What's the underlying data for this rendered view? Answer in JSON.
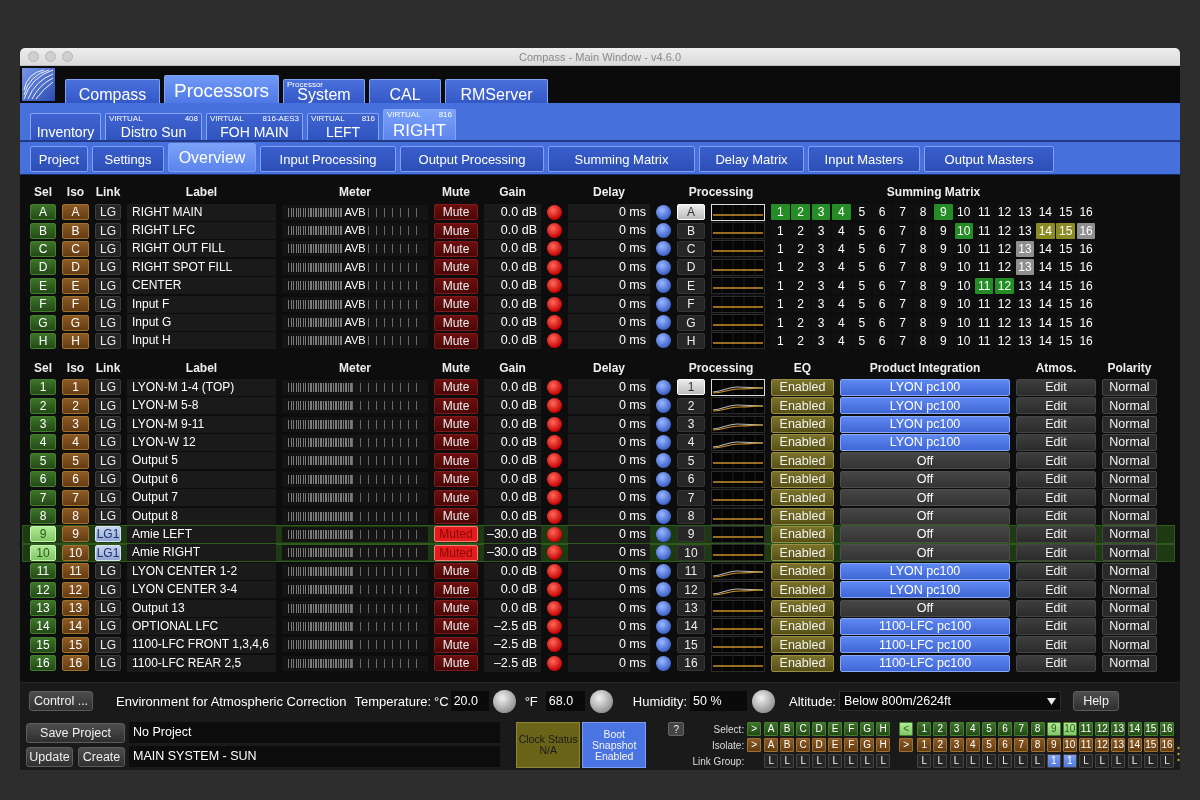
{
  "window": {
    "title": "Compass - Main Window - v4.6.0"
  },
  "main_tabs": [
    {
      "label": "Compass",
      "selected": false
    },
    {
      "label": "Processors",
      "selected": true
    },
    {
      "label": "System",
      "caption": "Processor",
      "selected": false
    },
    {
      "label": "CAL",
      "selected": false
    },
    {
      "label": "RMServer",
      "selected": false
    }
  ],
  "processor_tabs": [
    {
      "label": "Inventory",
      "selected": false
    },
    {
      "label": "Distro Sun",
      "tag": "VIRTUAL",
      "model": "408",
      "selected": false
    },
    {
      "label": "FOH MAIN",
      "tag": "VIRTUAL",
      "model": "816-AES3",
      "selected": false
    },
    {
      "label": "LEFT",
      "tag": "VIRTUAL",
      "model": "816",
      "selected": false
    },
    {
      "label": "RIGHT",
      "tag": "VIRTUAL",
      "model": "816",
      "selected": true
    }
  ],
  "view_tabs": [
    {
      "label": "Project",
      "selected": false
    },
    {
      "label": "Settings",
      "selected": false
    },
    {
      "label": "Overview",
      "selected": true
    },
    {
      "label": "Input Processing",
      "selected": false
    },
    {
      "label": "Output Processing",
      "selected": false
    },
    {
      "label": "Summing Matrix",
      "selected": false
    },
    {
      "label": "Delay Matrix",
      "selected": false
    },
    {
      "label": "Input Masters",
      "selected": false
    },
    {
      "label": "Output Masters",
      "selected": false
    }
  ],
  "inputs": {
    "columns": [
      "Sel",
      "Iso",
      "Link",
      "Label",
      "Meter",
      "Mute",
      "Gain",
      "Delay",
      "Processing",
      "Summing Matrix"
    ],
    "rows": [
      {
        "sel": "A",
        "iso": "A",
        "link": "LG",
        "linked": false,
        "label": "RIGHT MAIN",
        "meter_source": "AVB",
        "mute": "Mute",
        "muted": false,
        "gain": "0.0 dB",
        "delay": "0 ms",
        "processing": {
          "label": "A",
          "selected": true,
          "kind": "flat"
        },
        "selected": false,
        "matrix": [
          {
            "label": "1",
            "color": "#258d25"
          },
          {
            "label": "2",
            "color": "#258d25"
          },
          {
            "label": "3",
            "color": "#258d25"
          },
          {
            "label": "4",
            "color": "#258d25"
          },
          {
            "label": "5",
            "color": "#101010"
          },
          {
            "label": "6",
            "color": "#101010"
          },
          {
            "label": "7",
            "color": "#101010"
          },
          {
            "label": "8",
            "color": "#101010"
          },
          {
            "label": "9",
            "color": "#258d25"
          },
          {
            "label": "10",
            "color": "#101010"
          },
          {
            "label": "11",
            "color": "#101010"
          },
          {
            "label": "12",
            "color": "#101010"
          },
          {
            "label": "13",
            "color": "#101010"
          },
          {
            "label": "14",
            "color": "#101010"
          },
          {
            "label": "15",
            "color": "#101010"
          },
          {
            "label": "16",
            "color": "#101010"
          }
        ]
      },
      {
        "sel": "B",
        "iso": "B",
        "link": "LG",
        "linked": false,
        "label": "RIGHT LFC",
        "meter_source": "AVB",
        "mute": "Mute",
        "muted": false,
        "gain": "0.0 dB",
        "delay": "0 ms",
        "processing": {
          "label": "B",
          "selected": false,
          "kind": "flat"
        },
        "selected": false,
        "matrix": [
          {
            "label": "1",
            "color": "#101010"
          },
          {
            "label": "2",
            "color": "#101010"
          },
          {
            "label": "3",
            "color": "#101010"
          },
          {
            "label": "4",
            "color": "#101010"
          },
          {
            "label": "5",
            "color": "#101010"
          },
          {
            "label": "6",
            "color": "#101010"
          },
          {
            "label": "7",
            "color": "#101010"
          },
          {
            "label": "8",
            "color": "#101010"
          },
          {
            "label": "9",
            "color": "#101010"
          },
          {
            "label": "10",
            "color": "#258d25"
          },
          {
            "label": "11",
            "color": "#101010"
          },
          {
            "label": "12",
            "color": "#101010"
          },
          {
            "label": "13",
            "color": "#101010"
          },
          {
            "label": "14",
            "color": "#8b8b26"
          },
          {
            "label": "15",
            "color": "#8b8b26"
          },
          {
            "label": "16",
            "color": "#8f8f8f"
          }
        ]
      },
      {
        "sel": "C",
        "iso": "C",
        "link": "LG",
        "linked": false,
        "label": "RIGHT OUT FILL",
        "meter_source": "AVB",
        "mute": "Mute",
        "muted": false,
        "gain": "0.0 dB",
        "delay": "0 ms",
        "processing": {
          "label": "C",
          "selected": false,
          "kind": "flat"
        },
        "selected": false,
        "matrix": [
          {
            "label": "1",
            "color": "#101010"
          },
          {
            "label": "2",
            "color": "#101010"
          },
          {
            "label": "3",
            "color": "#101010"
          },
          {
            "label": "4",
            "color": "#101010"
          },
          {
            "label": "5",
            "color": "#101010"
          },
          {
            "label": "6",
            "color": "#101010"
          },
          {
            "label": "7",
            "color": "#101010"
          },
          {
            "label": "8",
            "color": "#101010"
          },
          {
            "label": "9",
            "color": "#101010"
          },
          {
            "label": "10",
            "color": "#101010"
          },
          {
            "label": "11",
            "color": "#101010"
          },
          {
            "label": "12",
            "color": "#101010"
          },
          {
            "label": "13",
            "color": "#8f8f8f"
          },
          {
            "label": "14",
            "color": "#101010"
          },
          {
            "label": "15",
            "color": "#101010"
          },
          {
            "label": "16",
            "color": "#101010"
          }
        ]
      },
      {
        "sel": "D",
        "iso": "D",
        "link": "LG",
        "linked": false,
        "label": "RIGHT SPOT FILL",
        "meter_source": "AVB",
        "mute": "Mute",
        "muted": false,
        "gain": "0.0 dB",
        "delay": "0 ms",
        "processing": {
          "label": "D",
          "selected": false,
          "kind": "flat"
        },
        "selected": false,
        "matrix": [
          {
            "label": "1",
            "color": "#101010"
          },
          {
            "label": "2",
            "color": "#101010"
          },
          {
            "label": "3",
            "color": "#101010"
          },
          {
            "label": "4",
            "color": "#101010"
          },
          {
            "label": "5",
            "color": "#101010"
          },
          {
            "label": "6",
            "color": "#101010"
          },
          {
            "label": "7",
            "color": "#101010"
          },
          {
            "label": "8",
            "color": "#101010"
          },
          {
            "label": "9",
            "color": "#101010"
          },
          {
            "label": "10",
            "color": "#101010"
          },
          {
            "label": "11",
            "color": "#101010"
          },
          {
            "label": "12",
            "color": "#101010"
          },
          {
            "label": "13",
            "color": "#8f8f8f"
          },
          {
            "label": "14",
            "color": "#101010"
          },
          {
            "label": "15",
            "color": "#101010"
          },
          {
            "label": "16",
            "color": "#101010"
          }
        ]
      },
      {
        "sel": "E",
        "iso": "E",
        "link": "LG",
        "linked": false,
        "label": "CENTER",
        "meter_source": "AVB",
        "mute": "Mute",
        "muted": false,
        "gain": "0.0 dB",
        "delay": "0 ms",
        "processing": {
          "label": "E",
          "selected": false,
          "kind": "flat"
        },
        "selected": false,
        "matrix": [
          {
            "label": "1",
            "color": "#101010"
          },
          {
            "label": "2",
            "color": "#101010"
          },
          {
            "label": "3",
            "color": "#101010"
          },
          {
            "label": "4",
            "color": "#101010"
          },
          {
            "label": "5",
            "color": "#101010"
          },
          {
            "label": "6",
            "color": "#101010"
          },
          {
            "label": "7",
            "color": "#101010"
          },
          {
            "label": "8",
            "color": "#101010"
          },
          {
            "label": "9",
            "color": "#101010"
          },
          {
            "label": "10",
            "color": "#101010"
          },
          {
            "label": "11",
            "color": "#258d25"
          },
          {
            "label": "12",
            "color": "#258d25"
          },
          {
            "label": "13",
            "color": "#101010"
          },
          {
            "label": "14",
            "color": "#101010"
          },
          {
            "label": "15",
            "color": "#101010"
          },
          {
            "label": "16",
            "color": "#101010"
          }
        ]
      },
      {
        "sel": "F",
        "iso": "F",
        "link": "LG",
        "linked": false,
        "label": "Input F",
        "meter_source": "AVB",
        "mute": "Mute",
        "muted": false,
        "gain": "0.0 dB",
        "delay": "0 ms",
        "processing": {
          "label": "F",
          "selected": false,
          "kind": "flat"
        },
        "selected": false,
        "matrix": [
          {
            "label": "1",
            "color": "#101010"
          },
          {
            "label": "2",
            "color": "#101010"
          },
          {
            "label": "3",
            "color": "#101010"
          },
          {
            "label": "4",
            "color": "#101010"
          },
          {
            "label": "5",
            "color": "#101010"
          },
          {
            "label": "6",
            "color": "#101010"
          },
          {
            "label": "7",
            "color": "#101010"
          },
          {
            "label": "8",
            "color": "#101010"
          },
          {
            "label": "9",
            "color": "#101010"
          },
          {
            "label": "10",
            "color": "#101010"
          },
          {
            "label": "11",
            "color": "#101010"
          },
          {
            "label": "12",
            "color": "#101010"
          },
          {
            "label": "13",
            "color": "#101010"
          },
          {
            "label": "14",
            "color": "#101010"
          },
          {
            "label": "15",
            "color": "#101010"
          },
          {
            "label": "16",
            "color": "#101010"
          }
        ]
      },
      {
        "sel": "G",
        "iso": "G",
        "link": "LG",
        "linked": false,
        "label": "Input G",
        "meter_source": "AVB",
        "mute": "Mute",
        "muted": false,
        "gain": "0.0 dB",
        "delay": "0 ms",
        "processing": {
          "label": "G",
          "selected": false,
          "kind": "flat"
        },
        "selected": false,
        "matrix": [
          {
            "label": "1",
            "color": "#101010"
          },
          {
            "label": "2",
            "color": "#101010"
          },
          {
            "label": "3",
            "color": "#101010"
          },
          {
            "label": "4",
            "color": "#101010"
          },
          {
            "label": "5",
            "color": "#101010"
          },
          {
            "label": "6",
            "color": "#101010"
          },
          {
            "label": "7",
            "color": "#101010"
          },
          {
            "label": "8",
            "color": "#101010"
          },
          {
            "label": "9",
            "color": "#101010"
          },
          {
            "label": "10",
            "color": "#101010"
          },
          {
            "label": "11",
            "color": "#101010"
          },
          {
            "label": "12",
            "color": "#101010"
          },
          {
            "label": "13",
            "color": "#101010"
          },
          {
            "label": "14",
            "color": "#101010"
          },
          {
            "label": "15",
            "color": "#101010"
          },
          {
            "label": "16",
            "color": "#101010"
          }
        ]
      },
      {
        "sel": "H",
        "iso": "H",
        "link": "LG",
        "linked": false,
        "label": "Input H",
        "meter_source": "AVB",
        "mute": "Mute",
        "muted": false,
        "gain": "0.0 dB",
        "delay": "0 ms",
        "processing": {
          "label": "H",
          "selected": false,
          "kind": "flat"
        },
        "selected": false,
        "matrix": [
          {
            "label": "1",
            "color": "#101010"
          },
          {
            "label": "2",
            "color": "#101010"
          },
          {
            "label": "3",
            "color": "#101010"
          },
          {
            "label": "4",
            "color": "#101010"
          },
          {
            "label": "5",
            "color": "#101010"
          },
          {
            "label": "6",
            "color": "#101010"
          },
          {
            "label": "7",
            "color": "#101010"
          },
          {
            "label": "8",
            "color": "#101010"
          },
          {
            "label": "9",
            "color": "#101010"
          },
          {
            "label": "10",
            "color": "#101010"
          },
          {
            "label": "11",
            "color": "#101010"
          },
          {
            "label": "12",
            "color": "#101010"
          },
          {
            "label": "13",
            "color": "#101010"
          },
          {
            "label": "14",
            "color": "#101010"
          },
          {
            "label": "15",
            "color": "#101010"
          },
          {
            "label": "16",
            "color": "#101010"
          }
        ]
      }
    ]
  },
  "outputs": {
    "columns": [
      "Sel",
      "Iso",
      "Link",
      "Label",
      "Meter",
      "Mute",
      "Gain",
      "Delay",
      "Processing",
      "EQ",
      "Product Integration",
      "Atmos.",
      "Polarity"
    ],
    "rows": [
      {
        "sel": "1",
        "iso": "1",
        "link": "LG",
        "linked": false,
        "label": "LYON-M 1-4 (TOP)",
        "mute": "Mute",
        "muted": false,
        "gain": "0.0 dB",
        "delay": "0 ms",
        "processing": {
          "label": "1",
          "selected": true,
          "kind": "shaped"
        },
        "selected": false,
        "eq": "Enabled",
        "integration": "LYON pc100",
        "integration_active": true,
        "atmos": "Edit",
        "polarity": "Normal"
      },
      {
        "sel": "2",
        "iso": "2",
        "link": "LG",
        "linked": false,
        "label": "LYON-M 5-8",
        "mute": "Mute",
        "muted": false,
        "gain": "0.0 dB",
        "delay": "0 ms",
        "processing": {
          "label": "2",
          "selected": false,
          "kind": "shaped"
        },
        "selected": false,
        "eq": "Enabled",
        "integration": "LYON pc100",
        "integration_active": true,
        "atmos": "Edit",
        "polarity": "Normal"
      },
      {
        "sel": "3",
        "iso": "3",
        "link": "LG",
        "linked": false,
        "label": "LYON-M 9-11",
        "mute": "Mute",
        "muted": false,
        "gain": "0.0 dB",
        "delay": "0 ms",
        "processing": {
          "label": "3",
          "selected": false,
          "kind": "shaped"
        },
        "selected": false,
        "eq": "Enabled",
        "integration": "LYON pc100",
        "integration_active": true,
        "atmos": "Edit",
        "polarity": "Normal"
      },
      {
        "sel": "4",
        "iso": "4",
        "link": "LG",
        "linked": false,
        "label": "LYON-W 12",
        "mute": "Mute",
        "muted": false,
        "gain": "0.0 dB",
        "delay": "0 ms",
        "processing": {
          "label": "4",
          "selected": false,
          "kind": "shaped"
        },
        "selected": false,
        "eq": "Enabled",
        "integration": "LYON pc100",
        "integration_active": true,
        "atmos": "Edit",
        "polarity": "Normal"
      },
      {
        "sel": "5",
        "iso": "5",
        "link": "LG",
        "linked": false,
        "label": "Output 5",
        "mute": "Mute",
        "muted": false,
        "gain": "0.0 dB",
        "delay": "0 ms",
        "processing": {
          "label": "5",
          "selected": false,
          "kind": "flat"
        },
        "selected": false,
        "eq": "Enabled",
        "integration": "Off",
        "integration_active": false,
        "atmos": "Edit",
        "polarity": "Normal"
      },
      {
        "sel": "6",
        "iso": "6",
        "link": "LG",
        "linked": false,
        "label": "Output 6",
        "mute": "Mute",
        "muted": false,
        "gain": "0.0 dB",
        "delay": "0 ms",
        "processing": {
          "label": "6",
          "selected": false,
          "kind": "flat"
        },
        "selected": false,
        "eq": "Enabled",
        "integration": "Off",
        "integration_active": false,
        "atmos": "Edit",
        "polarity": "Normal"
      },
      {
        "sel": "7",
        "iso": "7",
        "link": "LG",
        "linked": false,
        "label": "Output 7",
        "mute": "Mute",
        "muted": false,
        "gain": "0.0 dB",
        "delay": "0 ms",
        "processing": {
          "label": "7",
          "selected": false,
          "kind": "flat"
        },
        "selected": false,
        "eq": "Enabled",
        "integration": "Off",
        "integration_active": false,
        "atmos": "Edit",
        "polarity": "Normal"
      },
      {
        "sel": "8",
        "iso": "8",
        "link": "LG",
        "linked": false,
        "label": "Output 8",
        "mute": "Mute",
        "muted": false,
        "gain": "0.0 dB",
        "delay": "0 ms",
        "processing": {
          "label": "8",
          "selected": false,
          "kind": "flat"
        },
        "selected": false,
        "eq": "Enabled",
        "integration": "Off",
        "integration_active": false,
        "atmos": "Edit",
        "polarity": "Normal"
      },
      {
        "sel": "9",
        "iso": "9",
        "link": "LG1",
        "linked": true,
        "label": "Amie LEFT",
        "mute": "Muted",
        "muted": true,
        "gain": "–30.0 dB",
        "delay": "0 ms",
        "processing": {
          "label": "9",
          "selected": false,
          "kind": "flat"
        },
        "selected": true,
        "eq": "Enabled",
        "integration": "Off",
        "integration_active": false,
        "atmos": "Edit",
        "polarity": "Normal"
      },
      {
        "sel": "10",
        "iso": "10",
        "link": "LG1",
        "linked": true,
        "label": "Amie RIGHT",
        "mute": "Muted",
        "muted": true,
        "gain": "–30.0 dB",
        "delay": "0 ms",
        "processing": {
          "label": "10",
          "selected": false,
          "kind": "flat"
        },
        "selected": true,
        "eq": "Enabled",
        "integration": "Off",
        "integration_active": false,
        "atmos": "Edit",
        "polarity": "Normal"
      },
      {
        "sel": "11",
        "iso": "11",
        "link": "LG",
        "linked": false,
        "label": "LYON CENTER 1-2",
        "mute": "Mute",
        "muted": false,
        "gain": "0.0 dB",
        "delay": "0 ms",
        "processing": {
          "label": "11",
          "selected": false,
          "kind": "shaped"
        },
        "selected": false,
        "eq": "Enabled",
        "integration": "LYON pc100",
        "integration_active": true,
        "atmos": "Edit",
        "polarity": "Normal"
      },
      {
        "sel": "12",
        "iso": "12",
        "link": "LG",
        "linked": false,
        "label": "LYON CENTER 3-4",
        "mute": "Mute",
        "muted": false,
        "gain": "0.0 dB",
        "delay": "0 ms",
        "processing": {
          "label": "12",
          "selected": false,
          "kind": "shaped"
        },
        "selected": false,
        "eq": "Enabled",
        "integration": "LYON pc100",
        "integration_active": true,
        "atmos": "Edit",
        "polarity": "Normal"
      },
      {
        "sel": "13",
        "iso": "13",
        "link": "LG",
        "linked": false,
        "label": "Output 13",
        "mute": "Mute",
        "muted": false,
        "gain": "0.0 dB",
        "delay": "0 ms",
        "processing": {
          "label": "13",
          "selected": false,
          "kind": "flat"
        },
        "selected": false,
        "eq": "Enabled",
        "integration": "Off",
        "integration_active": false,
        "atmos": "Edit",
        "polarity": "Normal"
      },
      {
        "sel": "14",
        "iso": "14",
        "link": "LG",
        "linked": false,
        "label": "OPTIONAL LFC",
        "mute": "Mute",
        "muted": false,
        "gain": "–2.5 dB",
        "delay": "0 ms",
        "processing": {
          "label": "14",
          "selected": false,
          "kind": "flat"
        },
        "selected": false,
        "eq": "Enabled",
        "integration": "1100-LFC pc100",
        "integration_active": true,
        "atmos": "Edit",
        "polarity": "Normal"
      },
      {
        "sel": "15",
        "iso": "15",
        "link": "LG",
        "linked": false,
        "label": "1100-LFC FRONT 1,3,4,6",
        "mute": "Mute",
        "muted": false,
        "gain": "–2.5 dB",
        "delay": "0 ms",
        "processing": {
          "label": "15",
          "selected": false,
          "kind": "flat"
        },
        "selected": false,
        "eq": "Enabled",
        "integration": "1100-LFC pc100",
        "integration_active": true,
        "atmos": "Edit",
        "polarity": "Normal"
      },
      {
        "sel": "16",
        "iso": "16",
        "link": "LG",
        "linked": false,
        "label": "1100-LFC REAR 2,5",
        "mute": "Mute",
        "muted": false,
        "gain": "–2.5 dB",
        "delay": "0 ms",
        "processing": {
          "label": "16",
          "selected": false,
          "kind": "flat"
        },
        "selected": false,
        "eq": "Enabled",
        "integration": "1100-LFC pc100",
        "integration_active": true,
        "atmos": "Edit",
        "polarity": "Normal"
      }
    ]
  },
  "environment": {
    "control_button": "Control ...",
    "title": "Environment for Atmospheric Correction",
    "temperature_label": "Temperature:",
    "celsius_unit": "°C",
    "celsius": "20.0",
    "fahrenheit_unit": "°F",
    "fahrenheit": "68.0",
    "humidity_label": "Humidity:",
    "humidity": "50 %",
    "altitude_label": "Altitude:",
    "altitude": "Below 800m/2624ft",
    "help_button": "Help"
  },
  "project": {
    "save_button": "Save Project",
    "project_name": "No Project",
    "update_button": "Update",
    "create_button": "Create",
    "system_name": "MAIN SYSTEM - SUN"
  },
  "status": {
    "clock_title": "Clock Status",
    "clock_value": "N/A",
    "boot_snapshot": "Boot Snapshot Enabled"
  },
  "quick_select": {
    "help_button": "?",
    "rows": [
      {
        "kind": "select",
        "label": "Select:",
        "input_toggle": {
          "label": ">",
          "selected": false
        },
        "inputs": [
          {
            "label": "A",
            "selected": false
          },
          {
            "label": "B",
            "selected": false
          },
          {
            "label": "C",
            "selected": false
          },
          {
            "label": "D",
            "selected": false
          },
          {
            "label": "E",
            "selected": false
          },
          {
            "label": "F",
            "selected": false
          },
          {
            "label": "G",
            "selected": false
          },
          {
            "label": "H",
            "selected": false
          }
        ],
        "output_toggle": {
          "label": "<",
          "selected": true
        },
        "outputs": [
          {
            "label": "1",
            "selected": false
          },
          {
            "label": "2",
            "selected": false
          },
          {
            "label": "3",
            "selected": false
          },
          {
            "label": "4",
            "selected": false
          },
          {
            "label": "5",
            "selected": false
          },
          {
            "label": "6",
            "selected": false
          },
          {
            "label": "7",
            "selected": false
          },
          {
            "label": "8",
            "selected": false
          },
          {
            "label": "9",
            "selected": true
          },
          {
            "label": "10",
            "selected": true
          },
          {
            "label": "11",
            "selected": false
          },
          {
            "label": "12",
            "selected": false
          },
          {
            "label": "13",
            "selected": false
          },
          {
            "label": "14",
            "selected": false
          },
          {
            "label": "15",
            "selected": false
          },
          {
            "label": "16",
            "selected": false
          }
        ]
      },
      {
        "kind": "isolate",
        "label": "Isolate:",
        "input_toggle": {
          "label": ">",
          "selected": false
        },
        "inputs": [
          {
            "label": "A",
            "selected": false
          },
          {
            "label": "B",
            "selected": false
          },
          {
            "label": "C",
            "selected": false
          },
          {
            "label": "D",
            "selected": false
          },
          {
            "label": "E",
            "selected": false
          },
          {
            "label": "F",
            "selected": false
          },
          {
            "label": "G",
            "selected": false
          },
          {
            "label": "H",
            "selected": false
          }
        ],
        "output_toggle": {
          "label": ">",
          "selected": false
        },
        "outputs": [
          {
            "label": "1",
            "selected": false
          },
          {
            "label": "2",
            "selected": false
          },
          {
            "label": "3",
            "selected": false
          },
          {
            "label": "4",
            "selected": false
          },
          {
            "label": "5",
            "selected": false
          },
          {
            "label": "6",
            "selected": false
          },
          {
            "label": "7",
            "selected": false
          },
          {
            "label": "8",
            "selected": false
          },
          {
            "label": "9",
            "selected": false
          },
          {
            "label": "10",
            "selected": false
          },
          {
            "label": "11",
            "selected": false
          },
          {
            "label": "12",
            "selected": false
          },
          {
            "label": "13",
            "selected": false
          },
          {
            "label": "14",
            "selected": false
          },
          {
            "label": "15",
            "selected": false
          },
          {
            "label": "16",
            "selected": false
          }
        ]
      },
      {
        "kind": "link",
        "label": "Link Group:",
        "inputs": [
          {
            "label": "L",
            "selected": false
          },
          {
            "label": "L",
            "selected": false
          },
          {
            "label": "L",
            "selected": false
          },
          {
            "label": "L",
            "selected": false
          },
          {
            "label": "L",
            "selected": false
          },
          {
            "label": "L",
            "selected": false
          },
          {
            "label": "L",
            "selected": false
          },
          {
            "label": "L",
            "selected": false
          }
        ],
        "outputs": [
          {
            "label": "L",
            "selected": false
          },
          {
            "label": "L",
            "selected": false
          },
          {
            "label": "L",
            "selected": false
          },
          {
            "label": "L",
            "selected": false
          },
          {
            "label": "L",
            "selected": false
          },
          {
            "label": "L",
            "selected": false
          },
          {
            "label": "L",
            "selected": false
          },
          {
            "label": "L",
            "selected": false
          },
          {
            "label": "1",
            "selected": true
          },
          {
            "label": "1",
            "selected": true
          },
          {
            "label": "L",
            "selected": false
          },
          {
            "label": "L",
            "selected": false
          },
          {
            "label": "L",
            "selected": false
          },
          {
            "label": "L",
            "selected": false
          },
          {
            "label": "L",
            "selected": false
          },
          {
            "label": "L",
            "selected": false
          }
        ]
      }
    ]
  }
}
